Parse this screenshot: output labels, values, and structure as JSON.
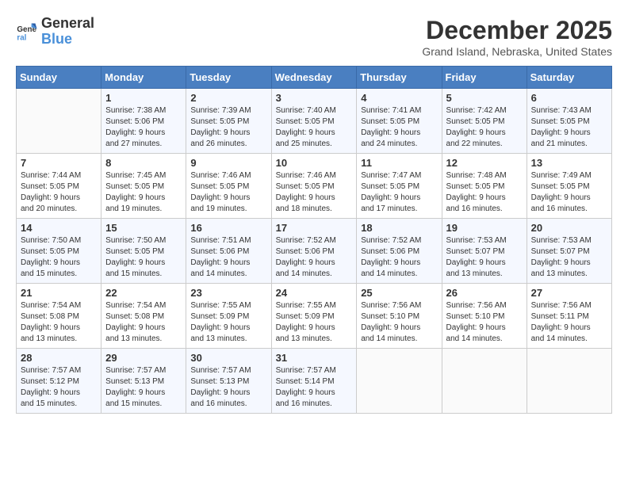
{
  "logo": {
    "text_general": "General",
    "text_blue": "Blue"
  },
  "title": "December 2025",
  "location": "Grand Island, Nebraska, United States",
  "days_of_week": [
    "Sunday",
    "Monday",
    "Tuesday",
    "Wednesday",
    "Thursday",
    "Friday",
    "Saturday"
  ],
  "weeks": [
    [
      {
        "day": "",
        "info": ""
      },
      {
        "day": "1",
        "info": "Sunrise: 7:38 AM\nSunset: 5:06 PM\nDaylight: 9 hours\nand 27 minutes."
      },
      {
        "day": "2",
        "info": "Sunrise: 7:39 AM\nSunset: 5:05 PM\nDaylight: 9 hours\nand 26 minutes."
      },
      {
        "day": "3",
        "info": "Sunrise: 7:40 AM\nSunset: 5:05 PM\nDaylight: 9 hours\nand 25 minutes."
      },
      {
        "day": "4",
        "info": "Sunrise: 7:41 AM\nSunset: 5:05 PM\nDaylight: 9 hours\nand 24 minutes."
      },
      {
        "day": "5",
        "info": "Sunrise: 7:42 AM\nSunset: 5:05 PM\nDaylight: 9 hours\nand 22 minutes."
      },
      {
        "day": "6",
        "info": "Sunrise: 7:43 AM\nSunset: 5:05 PM\nDaylight: 9 hours\nand 21 minutes."
      }
    ],
    [
      {
        "day": "7",
        "info": "Sunrise: 7:44 AM\nSunset: 5:05 PM\nDaylight: 9 hours\nand 20 minutes."
      },
      {
        "day": "8",
        "info": "Sunrise: 7:45 AM\nSunset: 5:05 PM\nDaylight: 9 hours\nand 19 minutes."
      },
      {
        "day": "9",
        "info": "Sunrise: 7:46 AM\nSunset: 5:05 PM\nDaylight: 9 hours\nand 19 minutes."
      },
      {
        "day": "10",
        "info": "Sunrise: 7:46 AM\nSunset: 5:05 PM\nDaylight: 9 hours\nand 18 minutes."
      },
      {
        "day": "11",
        "info": "Sunrise: 7:47 AM\nSunset: 5:05 PM\nDaylight: 9 hours\nand 17 minutes."
      },
      {
        "day": "12",
        "info": "Sunrise: 7:48 AM\nSunset: 5:05 PM\nDaylight: 9 hours\nand 16 minutes."
      },
      {
        "day": "13",
        "info": "Sunrise: 7:49 AM\nSunset: 5:05 PM\nDaylight: 9 hours\nand 16 minutes."
      }
    ],
    [
      {
        "day": "14",
        "info": "Sunrise: 7:50 AM\nSunset: 5:05 PM\nDaylight: 9 hours\nand 15 minutes."
      },
      {
        "day": "15",
        "info": "Sunrise: 7:50 AM\nSunset: 5:05 PM\nDaylight: 9 hours\nand 15 minutes."
      },
      {
        "day": "16",
        "info": "Sunrise: 7:51 AM\nSunset: 5:06 PM\nDaylight: 9 hours\nand 14 minutes."
      },
      {
        "day": "17",
        "info": "Sunrise: 7:52 AM\nSunset: 5:06 PM\nDaylight: 9 hours\nand 14 minutes."
      },
      {
        "day": "18",
        "info": "Sunrise: 7:52 AM\nSunset: 5:06 PM\nDaylight: 9 hours\nand 14 minutes."
      },
      {
        "day": "19",
        "info": "Sunrise: 7:53 AM\nSunset: 5:07 PM\nDaylight: 9 hours\nand 13 minutes."
      },
      {
        "day": "20",
        "info": "Sunrise: 7:53 AM\nSunset: 5:07 PM\nDaylight: 9 hours\nand 13 minutes."
      }
    ],
    [
      {
        "day": "21",
        "info": "Sunrise: 7:54 AM\nSunset: 5:08 PM\nDaylight: 9 hours\nand 13 minutes."
      },
      {
        "day": "22",
        "info": "Sunrise: 7:54 AM\nSunset: 5:08 PM\nDaylight: 9 hours\nand 13 minutes."
      },
      {
        "day": "23",
        "info": "Sunrise: 7:55 AM\nSunset: 5:09 PM\nDaylight: 9 hours\nand 13 minutes."
      },
      {
        "day": "24",
        "info": "Sunrise: 7:55 AM\nSunset: 5:09 PM\nDaylight: 9 hours\nand 13 minutes."
      },
      {
        "day": "25",
        "info": "Sunrise: 7:56 AM\nSunset: 5:10 PM\nDaylight: 9 hours\nand 14 minutes."
      },
      {
        "day": "26",
        "info": "Sunrise: 7:56 AM\nSunset: 5:10 PM\nDaylight: 9 hours\nand 14 minutes."
      },
      {
        "day": "27",
        "info": "Sunrise: 7:56 AM\nSunset: 5:11 PM\nDaylight: 9 hours\nand 14 minutes."
      }
    ],
    [
      {
        "day": "28",
        "info": "Sunrise: 7:57 AM\nSunset: 5:12 PM\nDaylight: 9 hours\nand 15 minutes."
      },
      {
        "day": "29",
        "info": "Sunrise: 7:57 AM\nSunset: 5:13 PM\nDaylight: 9 hours\nand 15 minutes."
      },
      {
        "day": "30",
        "info": "Sunrise: 7:57 AM\nSunset: 5:13 PM\nDaylight: 9 hours\nand 16 minutes."
      },
      {
        "day": "31",
        "info": "Sunrise: 7:57 AM\nSunset: 5:14 PM\nDaylight: 9 hours\nand 16 minutes."
      },
      {
        "day": "",
        "info": ""
      },
      {
        "day": "",
        "info": ""
      },
      {
        "day": "",
        "info": ""
      }
    ]
  ]
}
